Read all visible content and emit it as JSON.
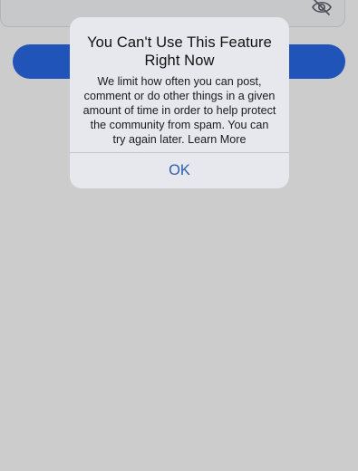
{
  "alert": {
    "title": "You Can't Use This Feature Right Now",
    "message": "We limit how often you can post, comment or do other things in a given amount of time in order to help protect the community from spam. You can try again later. Learn More",
    "ok_label": "OK"
  },
  "icons": {
    "password_toggle": "eye-slash-icon"
  },
  "colors": {
    "backdrop": "#cccccc",
    "dialog_background": "#e6e8ed",
    "action_text": "#2b5fb0",
    "login_button": "#2154b8"
  }
}
